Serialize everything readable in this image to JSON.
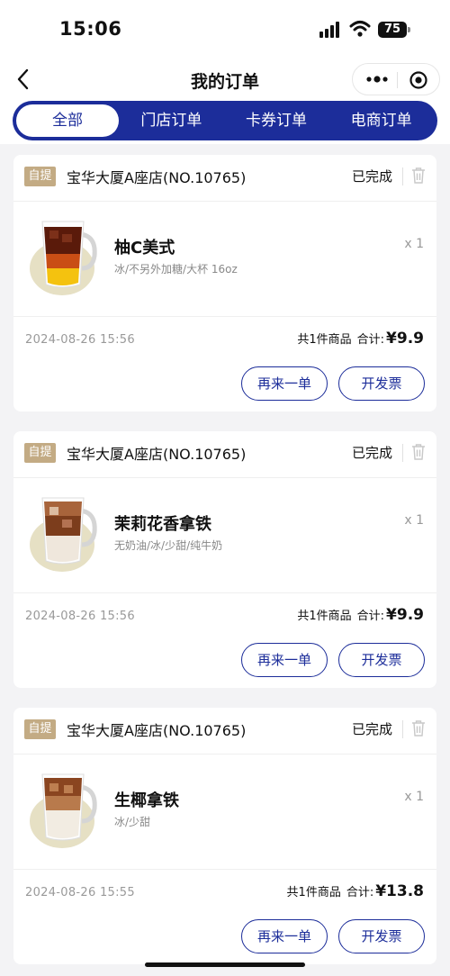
{
  "status_bar": {
    "time": "15:06",
    "battery": "75"
  },
  "nav": {
    "title": "我的订单"
  },
  "tabs": [
    {
      "label": "全部",
      "active": true
    },
    {
      "label": "门店订单",
      "active": false
    },
    {
      "label": "卡券订单",
      "active": false
    },
    {
      "label": "电商订单",
      "active": false
    }
  ],
  "orders": [
    {
      "badge": "自提",
      "store": "宝华大厦A座店(NO.10765)",
      "status": "已完成",
      "product": {
        "name": "柚C美式",
        "spec": "冰/不另外加糖/大杯 16oz",
        "qty": "x 1"
      },
      "date": "2024-08-26 15:56",
      "count": "共1件商品",
      "total_label": "合计:",
      "price": "¥9.9",
      "reorder": "再来一单",
      "invoice": "开发票"
    },
    {
      "badge": "自提",
      "store": "宝华大厦A座店(NO.10765)",
      "status": "已完成",
      "product": {
        "name": "茉莉花香拿铁",
        "spec": "无奶油/冰/少甜/纯牛奶",
        "qty": "x 1"
      },
      "date": "2024-08-26 15:56",
      "count": "共1件商品",
      "total_label": "合计:",
      "price": "¥9.9",
      "reorder": "再来一单",
      "invoice": "开发票"
    },
    {
      "badge": "自提",
      "store": "宝华大厦A座店(NO.10765)",
      "status": "已完成",
      "product": {
        "name": "生椰拿铁",
        "spec": "冰/少甜",
        "qty": "x 1"
      },
      "date": "2024-08-26 15:55",
      "count": "共1件商品",
      "total_label": "合计:",
      "price": "¥13.8",
      "reorder": "再来一单",
      "invoice": "开发票"
    }
  ],
  "colors": {
    "brand": "#1c2d9a",
    "badge": "#c3ab84",
    "background": "#f3f3f5"
  },
  "icons": [
    "back-icon",
    "more-icon",
    "close-mini-program-icon",
    "trash-icon",
    "cellular-icon",
    "wifi-icon",
    "battery-icon"
  ]
}
